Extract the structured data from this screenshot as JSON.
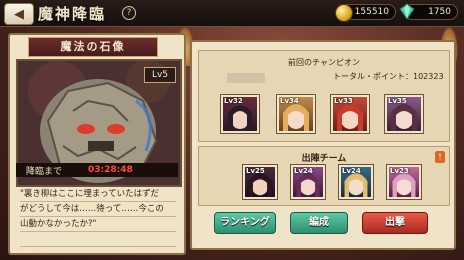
{
  "header": {
    "back_label": "◀",
    "title": "魔神降臨",
    "help_label": "?",
    "coins": "155510",
    "gems": "1750"
  },
  "boss": {
    "banner": "魔法の石像",
    "level": "Lv5",
    "descent_label": "降臨まで",
    "timer": "03:28:48",
    "quote": [
      "\"裏き柳はここに埋まっていたはずだ",
      "がどうして今は……待って……今この",
      "山動かなかったか?\""
    ]
  },
  "champion": {
    "header": "前回のチャンピオン",
    "total_power": "トータル・ポイント：102323",
    "members": [
      {
        "level": "Lv32"
      },
      {
        "level": "Lv34"
      },
      {
        "level": "Lv33"
      },
      {
        "level": "Lv35"
      }
    ]
  },
  "team": {
    "header": "出陣チーム",
    "info_label": "!",
    "members": [
      {
        "level": "Lv25"
      },
      {
        "level": "Lv24"
      },
      {
        "level": "Lv24"
      },
      {
        "level": "Lv23"
      }
    ]
  },
  "buttons": {
    "ranking": "ランキング",
    "formation": "編成",
    "sortie": "出撃"
  }
}
